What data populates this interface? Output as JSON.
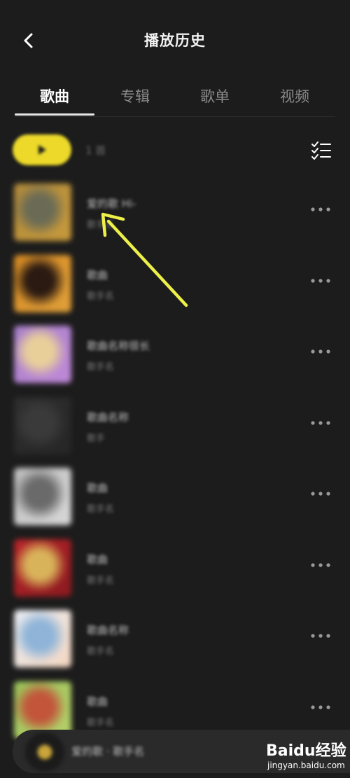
{
  "header": {
    "title": "播放历史"
  },
  "tabs": [
    {
      "label": "歌曲",
      "active": true
    },
    {
      "label": "专辑",
      "active": false
    },
    {
      "label": "歌单",
      "active": false
    },
    {
      "label": "视频",
      "active": false
    }
  ],
  "play_all": {
    "label": "1 首"
  },
  "songs": [
    {
      "title": "爱的歌 Hi-",
      "artist": "歌手名",
      "cover_colors": [
        "#b08a3a",
        "#6b6b55",
        "#c79a3c"
      ]
    },
    {
      "title": "歌曲",
      "artist": "歌手名",
      "cover_colors": [
        "#d68a22",
        "#2a1a12",
        "#e0a03a"
      ]
    },
    {
      "title": "歌曲名称很长",
      "artist": "歌手名",
      "cover_colors": [
        "#a77fc9",
        "#e8cf9a",
        "#c08ad8"
      ]
    },
    {
      "title": "歌曲名称",
      "artist": "歌手",
      "cover_colors": [
        "#2e2e2e",
        "#3a3a3a",
        "#262626"
      ]
    },
    {
      "title": "歌曲",
      "artist": "歌手名",
      "cover_colors": [
        "#bdbdbd",
        "#6a6a6a",
        "#d8d8d8"
      ]
    },
    {
      "title": "歌曲",
      "artist": "歌手名",
      "cover_colors": [
        "#b8242a",
        "#d9b35a",
        "#8a1a1f"
      ]
    },
    {
      "title": "歌曲名称",
      "artist": "歌手名",
      "cover_colors": [
        "#e8edf5",
        "#8fb4d8",
        "#f3d6c0"
      ]
    },
    {
      "title": "歌曲",
      "artist": "歌手名",
      "cover_colors": [
        "#9ac25a",
        "#c2553a",
        "#b7d06a"
      ]
    }
  ],
  "mini_player": {
    "title": "爱的歌 · 歌手名"
  },
  "watermark": {
    "logo_left": "Bai",
    "logo_mid": "du",
    "logo_right": "经验",
    "url": "jingyan.baidu.com"
  },
  "colors": {
    "background": "#1c1c1c",
    "accent_yellow": "#ecd92a",
    "annotation_arrow": "#eef04a"
  }
}
